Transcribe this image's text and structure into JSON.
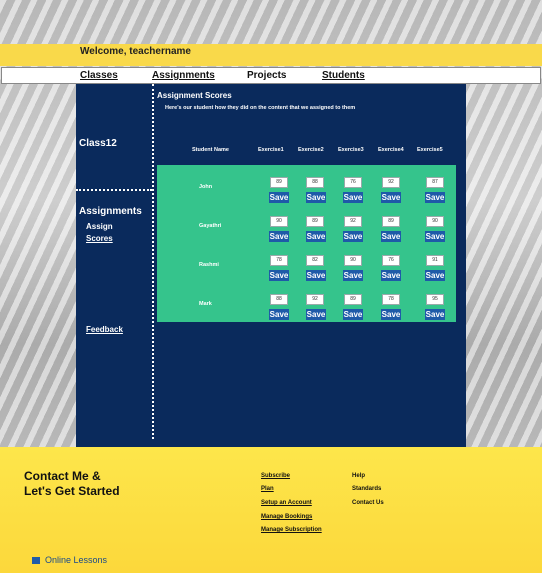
{
  "welcome": "Welcome, teachername",
  "nav": [
    "Classes",
    "Assignments",
    "Projects",
    "Students"
  ],
  "sidebar": {
    "class_label": "Class12",
    "assignments_heading": "Assignments",
    "assign": "Assign",
    "scores": "Scores",
    "feedback": "Feedback"
  },
  "main": {
    "title": "Assignment Scores",
    "subtitle": "Here's our student  how they did on the content that we assigned to them",
    "columns": [
      "Student Name",
      "Exercise1",
      "Exercise2",
      "Exercise3",
      "Exercise4",
      "Exercise5"
    ],
    "save_label": "Save",
    "rows": [
      {
        "name": "John",
        "scores": [
          "89",
          "88",
          "76",
          "92",
          "87"
        ]
      },
      {
        "name": "Gayathri",
        "scores": [
          "90",
          "89",
          "92",
          "89",
          "90"
        ]
      },
      {
        "name": "Rashmi",
        "scores": [
          "78",
          "82",
          "90",
          "76",
          "91"
        ]
      },
      {
        "name": "Mark",
        "scores": [
          "88",
          "92",
          "89",
          "78",
          "95"
        ]
      }
    ]
  },
  "footer": {
    "contact_line1": "Contact Me &",
    "contact_line2": "Let's Get Started",
    "links_col1": [
      "Subscribe",
      "Plan",
      "Setup an Account",
      "Manage Bookings",
      "Manage Subscription"
    ],
    "links_col2": [
      "Help",
      "Standards",
      "Contact Us"
    ],
    "online": "Online Lessons"
  }
}
